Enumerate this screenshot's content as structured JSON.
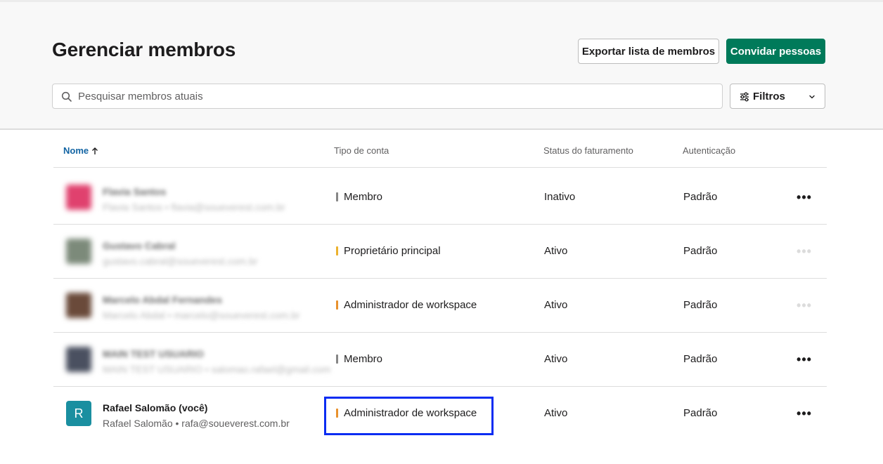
{
  "header": {
    "title": "Gerenciar membros",
    "export_label": "Exportar lista de membros",
    "invite_label": "Convidar pessoas",
    "search_placeholder": "Pesquisar membros atuais",
    "filters_label": "Filtros"
  },
  "table": {
    "columns": {
      "name": "Nome",
      "type": "Tipo de conta",
      "billing": "Status do faturamento",
      "auth": "Autenticação"
    },
    "rows": [
      {
        "name": "Flavia Santos",
        "sub": "Flavia Santos • flavia@soueverest.com.br",
        "type": "Membro",
        "type_color": "#868686",
        "billing": "Inativo",
        "auth": "Padrão",
        "avatar_color": "#e0416e",
        "blurred": true,
        "more_active": true
      },
      {
        "name": "Gustavo Cabral",
        "sub": "gustavo.cabral@soueverest.com.br",
        "type": "Proprietário principal",
        "type_color": "#ecb22e",
        "billing": "Ativo",
        "auth": "Padrão",
        "avatar_color": "#7c8a7a",
        "blurred": true,
        "more_active": false
      },
      {
        "name": "Marcelo Abdal Fernandes",
        "sub": "Marcelo Abdal • marcelo@soueverest.com.br",
        "type": "Administrador de workspace",
        "type_color": "#e8912d",
        "billing": "Ativo",
        "auth": "Padrão",
        "avatar_color": "#6a4a3a",
        "blurred": true,
        "more_active": false
      },
      {
        "name": "MAIN TEST USUARIO",
        "sub": "MAIN TEST USUARIO • salomao.rafael@gmail.com",
        "type": "Membro",
        "type_color": "#868686",
        "billing": "Ativo",
        "auth": "Padrão",
        "avatar_color": "#4a5060",
        "blurred": true,
        "more_active": true
      },
      {
        "name": "Rafael Salomão (você)",
        "sub": "Rafael Salomão • rafa@soueverest.com.br",
        "type": "Administrador de workspace",
        "type_color": "#e8912d",
        "billing": "Ativo",
        "auth": "Padrão",
        "avatar_letter": "R",
        "avatar_color": "#1a8fa0",
        "blurred": false,
        "more_active": true
      }
    ]
  },
  "colors": {
    "accent_green": "#007a5a",
    "link_blue": "#1264a3",
    "highlight": "#0a2cf2"
  }
}
